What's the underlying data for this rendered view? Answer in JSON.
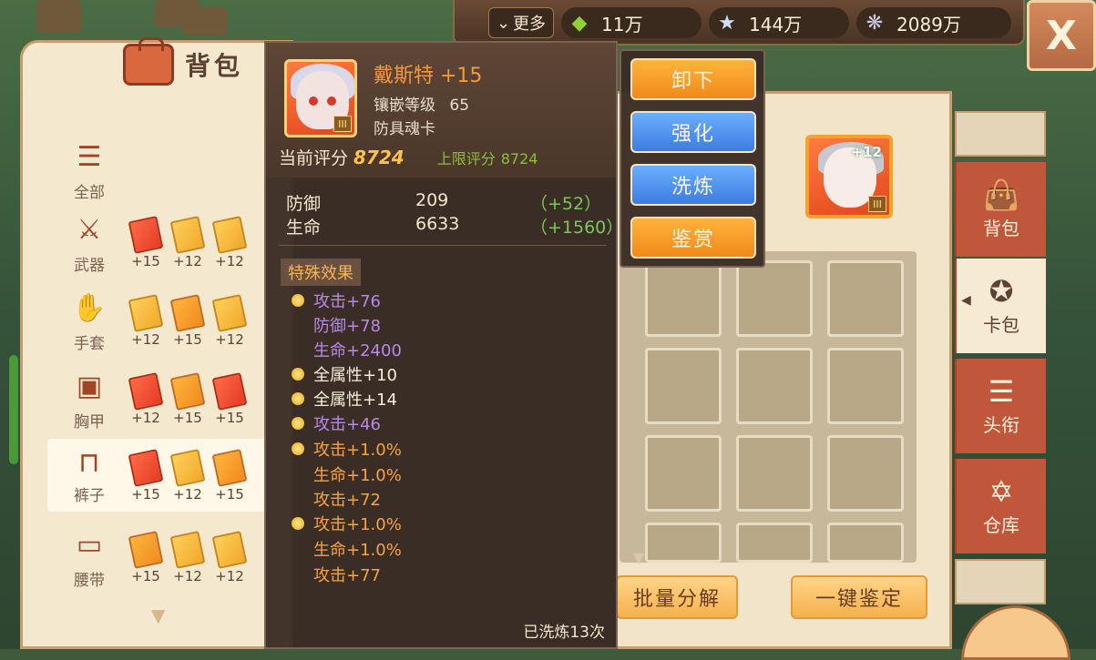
{
  "topbar": {
    "more_label": "更多",
    "currencies": [
      {
        "icon": "green-gem-icon",
        "value": "11万"
      },
      {
        "icon": "star-icon",
        "value": "144万"
      },
      {
        "icon": "shell-icon",
        "value": "2089万"
      }
    ],
    "close_label": "X"
  },
  "left_panel": {
    "title": "背包",
    "categories": [
      {
        "label": "全部",
        "icon": "list-icon",
        "cards": []
      },
      {
        "label": "武器",
        "icon": "sword-icon",
        "cards": [
          "+15",
          "+12",
          "+12"
        ]
      },
      {
        "label": "手套",
        "icon": "glove-icon",
        "cards": [
          "+12",
          "+15",
          "+12"
        ]
      },
      {
        "label": "胸甲",
        "icon": "armor-icon",
        "cards": [
          "+12",
          "+15",
          "+15"
        ]
      },
      {
        "label": "裤子",
        "icon": "pants-icon",
        "cards": [
          "+15",
          "+12",
          "+15"
        ]
      },
      {
        "label": "腰带",
        "icon": "belt-icon",
        "cards": [
          "+15",
          "+12",
          "+12"
        ]
      }
    ]
  },
  "item": {
    "name": "戴斯特 +15",
    "inlay_label": "镶嵌等级",
    "inlay_value": "65",
    "type": "防具魂卡",
    "rarity": "III",
    "score_label": "当前评分",
    "score_value": "8724",
    "max_label": "上限评分",
    "max_value": "8724",
    "stats": [
      {
        "name": "防御",
        "value": "209",
        "bonus": "（+52）"
      },
      {
        "name": "生命",
        "value": "6633",
        "bonus": "（+1560）"
      }
    ],
    "special_title": "特殊效果",
    "effects": [
      {
        "text": "攻击+76",
        "color": "purple",
        "dot": true
      },
      {
        "text": "防御+78",
        "color": "purple",
        "dot": false
      },
      {
        "text": "生命+2400",
        "color": "purple",
        "dot": false
      },
      {
        "text": "全属性+10",
        "color": "white",
        "dot": true
      },
      {
        "text": "全属性+14",
        "color": "white",
        "dot": true
      },
      {
        "text": "攻击+46",
        "color": "purple",
        "dot": true
      },
      {
        "text": "攻击+1.0%",
        "color": "orange",
        "dot": true
      },
      {
        "text": "生命+1.0%",
        "color": "orange",
        "dot": false
      },
      {
        "text": "攻击+72",
        "color": "orange",
        "dot": false
      },
      {
        "text": "攻击+1.0%",
        "color": "orange",
        "dot": true
      },
      {
        "text": "生命+1.0%",
        "color": "orange",
        "dot": false
      },
      {
        "text": "攻击+77",
        "color": "orange",
        "dot": false
      }
    ],
    "refined_text": "已洗炼13次"
  },
  "actions": [
    {
      "label": "卸下",
      "style": "orange"
    },
    {
      "label": "强化",
      "style": "blue"
    },
    {
      "label": "洗炼",
      "style": "blue"
    },
    {
      "label": "鉴赏",
      "style": "orange"
    }
  ],
  "equipped": {
    "level": "+12",
    "rarity": "III"
  },
  "bottom_buttons": {
    "batch": "批量分解",
    "appraise": "一键鉴定"
  },
  "tabs": [
    {
      "label": "背包",
      "icon": "bag-icon",
      "active": false
    },
    {
      "label": "卡包",
      "icon": "card-pack-icon",
      "active": true
    },
    {
      "label": "头衔",
      "icon": "scroll-icon",
      "active": false
    },
    {
      "label": "仓库",
      "icon": "star-of-david-icon",
      "active": false
    }
  ],
  "colors": {
    "purple": "#b58ae8",
    "orange": "#f5a24a",
    "green": "#7ac75a",
    "gold": "#ffc24a"
  }
}
